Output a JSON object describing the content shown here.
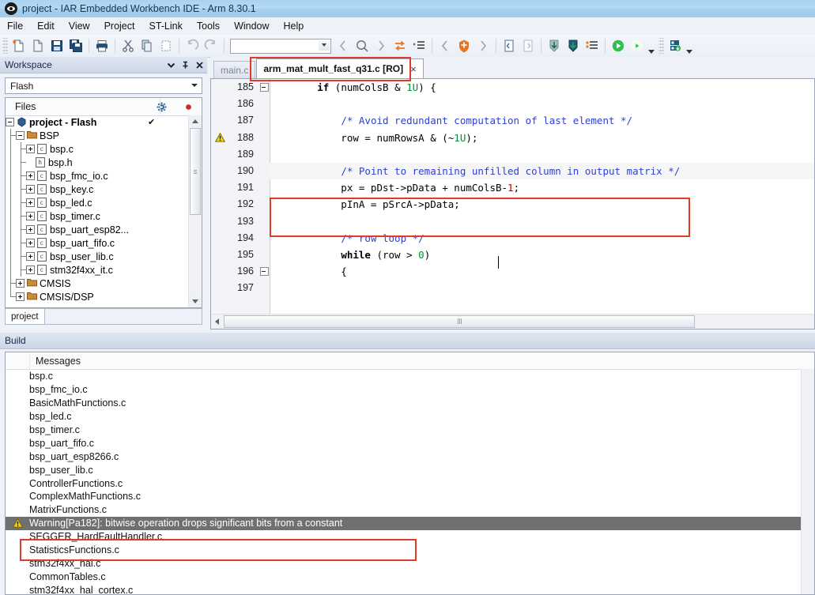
{
  "window": {
    "title": "project - IAR Embedded Workbench IDE - Arm 8.30.1",
    "app_icon": "iar-logo-icon"
  },
  "menu": {
    "items": [
      "File",
      "Edit",
      "View",
      "Project",
      "ST-Link",
      "Tools",
      "Window",
      "Help"
    ]
  },
  "toolbar": {
    "search_value": "",
    "search_placeholder": "",
    "buttons": [
      "new-document-icon",
      "open-document-icon",
      "save-icon",
      "save-all-icon",
      "print-icon",
      "cut-icon",
      "copy-icon",
      "paste-icon",
      "undo-icon",
      "redo-icon",
      "navigate-back-icon",
      "quick-search-icon",
      "navigate-forward-icon",
      "toggle-bookmark-icon",
      "goto-bookmark-icon",
      "previous-error-icon",
      "make-icon",
      "next-error-icon",
      "compile-icon",
      "stop-build-icon",
      "download-icon",
      "download-active-icon",
      "debug-log-icon",
      "run-icon",
      "run-to-cursor-icon",
      "debug-options-icon",
      "workspace-icon"
    ]
  },
  "workspace": {
    "panel_title": "Workspace",
    "header_buttons": [
      "dropdown-menu-icon",
      "pin-icon",
      "close-icon"
    ],
    "config_selected": "Flash",
    "column_headers": {
      "files": "Files",
      "settings_icon": "gear-icon",
      "status_icon": "red-dot-icon"
    },
    "bottom_tab": "project",
    "tree": [
      {
        "label": "project - Flash",
        "depth": 0,
        "icon": "project-icon",
        "expander": "minus",
        "bold": true,
        "check": "✔"
      },
      {
        "label": "BSP",
        "depth": 1,
        "icon": "folder-icon",
        "expander": "minus",
        "bold": false,
        "check": ""
      },
      {
        "label": "bsp.c",
        "depth": 2,
        "icon": "c-file-icon",
        "expander": "plus",
        "bold": false,
        "check": ""
      },
      {
        "label": "bsp.h",
        "depth": 2,
        "icon": "h-file-icon",
        "expander": "none",
        "bold": false,
        "check": ""
      },
      {
        "label": "bsp_fmc_io.c",
        "depth": 2,
        "icon": "c-file-icon",
        "expander": "plus",
        "bold": false,
        "check": ""
      },
      {
        "label": "bsp_key.c",
        "depth": 2,
        "icon": "c-file-icon",
        "expander": "plus",
        "bold": false,
        "check": ""
      },
      {
        "label": "bsp_led.c",
        "depth": 2,
        "icon": "c-file-icon",
        "expander": "plus",
        "bold": false,
        "check": ""
      },
      {
        "label": "bsp_timer.c",
        "depth": 2,
        "icon": "c-file-icon",
        "expander": "plus",
        "bold": false,
        "check": ""
      },
      {
        "label": "bsp_uart_esp82...",
        "depth": 2,
        "icon": "c-file-icon",
        "expander": "plus",
        "bold": false,
        "check": ""
      },
      {
        "label": "bsp_uart_fifo.c",
        "depth": 2,
        "icon": "c-file-icon",
        "expander": "plus",
        "bold": false,
        "check": ""
      },
      {
        "label": "bsp_user_lib.c",
        "depth": 2,
        "icon": "c-file-icon",
        "expander": "plus",
        "bold": false,
        "check": ""
      },
      {
        "label": "stm32f4xx_it.c",
        "depth": 2,
        "icon": "c-file-icon",
        "expander": "plus",
        "bold": false,
        "check": ""
      },
      {
        "label": "CMSIS",
        "depth": 1,
        "icon": "folder-icon",
        "expander": "plus",
        "bold": false,
        "check": ""
      },
      {
        "label": "CMSIS/DSP",
        "depth": 1,
        "icon": "folder-icon",
        "expander": "plus",
        "bold": false,
        "check": ""
      }
    ]
  },
  "editor": {
    "tabs": [
      {
        "label": "main.c",
        "active": false,
        "closable": false
      },
      {
        "label": "arm_mat_mult_fast_q31.c [RO]",
        "active": true,
        "closable": true,
        "close_label": "×"
      }
    ],
    "first_line_number": 185,
    "lines": [
      {
        "num": 185,
        "fold": "minus",
        "warn": false,
        "highlight": false,
        "tokens": [
          {
            "t": "        ",
            "c": "pl"
          },
          {
            "t": "if",
            "c": "kw"
          },
          {
            "t": " (numColsB & ",
            "c": "pl"
          },
          {
            "t": "1U",
            "c": "num"
          },
          {
            "t": ") {",
            "c": "pl"
          }
        ]
      },
      {
        "num": 186,
        "fold": "none",
        "warn": false,
        "highlight": false,
        "tokens": []
      },
      {
        "num": 187,
        "fold": "none",
        "warn": false,
        "highlight": false,
        "tokens": [
          {
            "t": "            ",
            "c": "pl"
          },
          {
            "t": "/* Avoid redundant computation of last element */",
            "c": "cm"
          }
        ]
      },
      {
        "num": 188,
        "fold": "none",
        "warn": true,
        "highlight": false,
        "tokens": [
          {
            "t": "            row = numRowsA & (~",
            "c": "pl"
          },
          {
            "t": "1U",
            "c": "num"
          },
          {
            "t": ");",
            "c": "pl"
          }
        ]
      },
      {
        "num": 189,
        "fold": "none",
        "warn": false,
        "highlight": false,
        "tokens": []
      },
      {
        "num": 190,
        "fold": "none",
        "warn": false,
        "highlight": true,
        "tokens": [
          {
            "t": "            ",
            "c": "pl"
          },
          {
            "t": "/* Point to remaining unfilled column in output matrix */",
            "c": "cm"
          }
        ]
      },
      {
        "num": 191,
        "fold": "none",
        "warn": false,
        "highlight": false,
        "tokens": [
          {
            "t": "            px = pDst->pData + numColsB-",
            "c": "pl"
          },
          {
            "t": "1",
            "c": "num2"
          },
          {
            "t": ";",
            "c": "pl"
          }
        ]
      },
      {
        "num": 192,
        "fold": "none",
        "warn": false,
        "highlight": false,
        "tokens": [
          {
            "t": "            pInA = pSrcA->pData;",
            "c": "pl"
          }
        ]
      },
      {
        "num": 193,
        "fold": "none",
        "warn": false,
        "highlight": false,
        "tokens": []
      },
      {
        "num": 194,
        "fold": "none",
        "warn": false,
        "highlight": false,
        "tokens": [
          {
            "t": "            ",
            "c": "pl"
          },
          {
            "t": "/* row loop */",
            "c": "cm"
          }
        ]
      },
      {
        "num": 195,
        "fold": "none",
        "warn": false,
        "highlight": false,
        "tokens": [
          {
            "t": "            ",
            "c": "pl"
          },
          {
            "t": "while",
            "c": "kw"
          },
          {
            "t": " (row > ",
            "c": "pl"
          },
          {
            "t": "0",
            "c": "num"
          },
          {
            "t": ")",
            "c": "pl"
          }
        ]
      },
      {
        "num": 196,
        "fold": "minus",
        "warn": false,
        "highlight": false,
        "tokens": [
          {
            "t": "            {",
            "c": "pl"
          }
        ]
      },
      {
        "num": 197,
        "fold": "none",
        "warn": false,
        "highlight": false,
        "tokens": []
      }
    ]
  },
  "build": {
    "panel_title": "Build",
    "column_header": "Messages",
    "rows": [
      {
        "text": "bsp.c",
        "selected": false,
        "icon": ""
      },
      {
        "text": "bsp_fmc_io.c",
        "selected": false,
        "icon": ""
      },
      {
        "text": "BasicMathFunctions.c",
        "selected": false,
        "icon": ""
      },
      {
        "text": "bsp_led.c",
        "selected": false,
        "icon": ""
      },
      {
        "text": "bsp_timer.c",
        "selected": false,
        "icon": ""
      },
      {
        "text": "bsp_uart_fifo.c",
        "selected": false,
        "icon": ""
      },
      {
        "text": "bsp_uart_esp8266.c",
        "selected": false,
        "icon": ""
      },
      {
        "text": "bsp_user_lib.c",
        "selected": false,
        "icon": ""
      },
      {
        "text": "ControllerFunctions.c",
        "selected": false,
        "icon": ""
      },
      {
        "text": "ComplexMathFunctions.c",
        "selected": false,
        "icon": ""
      },
      {
        "text": "MatrixFunctions.c",
        "selected": false,
        "icon": ""
      },
      {
        "text": "Warning[Pa182]: bitwise operation drops significant bits from a constant",
        "selected": true,
        "icon": "warning-icon"
      },
      {
        "text": "SEGGER_HardFaultHandler.c",
        "selected": false,
        "icon": ""
      },
      {
        "text": "StatisticsFunctions.c",
        "selected": false,
        "icon": ""
      },
      {
        "text": "stm32f4xx_hal.c",
        "selected": false,
        "icon": ""
      },
      {
        "text": "CommonTables.c",
        "selected": false,
        "icon": ""
      },
      {
        "text": "stm32f4xx_hal_cortex.c",
        "selected": false,
        "icon": ""
      }
    ]
  },
  "annotations": {
    "accent_color": "#e03a28",
    "boxes": [
      "editor-tab-highlight",
      "code-block-highlight",
      "build-warning-highlight"
    ]
  }
}
